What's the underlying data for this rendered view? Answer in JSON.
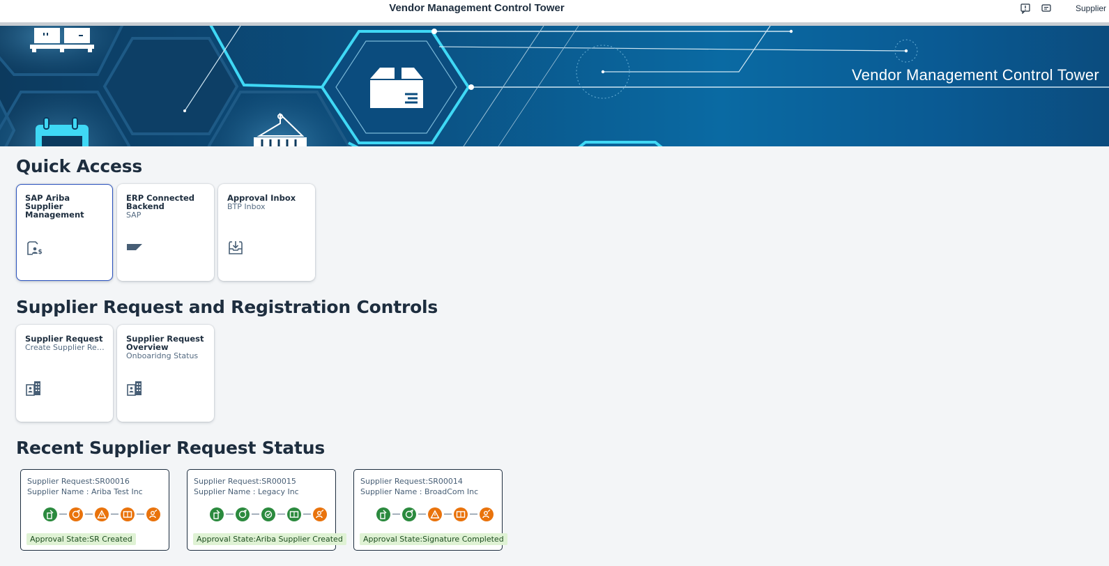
{
  "shell": {
    "title": "Vendor Management Control Tower",
    "user_label": "Supplier",
    "icons": [
      "feedback-icon",
      "notification-icon"
    ]
  },
  "banner": {
    "title": "Vendor Management Control Tower",
    "decorative_icons": [
      "pallet-icon",
      "box-icon",
      "calendar-icon",
      "container-icon"
    ]
  },
  "sections": {
    "quick_access": "Quick Access",
    "controls": "Supplier Request and Registration Controls",
    "recent": "Recent Supplier Request Status"
  },
  "quick_access_tiles": [
    {
      "title": "SAP Ariba Supplier Management",
      "subtitle": "",
      "icon": "supplier-management-icon"
    },
    {
      "title": "ERP Connected Backend",
      "subtitle": "SAP",
      "icon": "sap-backend-icon"
    },
    {
      "title": "Approval Inbox",
      "subtitle": "BTP Inbox",
      "icon": "inbox-download-icon"
    }
  ],
  "control_tiles": [
    {
      "title": "Supplier Request",
      "subtitle": "Create Supplier Req...",
      "icon": "building-icon"
    },
    {
      "title": "Supplier Request Overview",
      "subtitle": "Onboaridng Status",
      "icon": "building-icon"
    }
  ],
  "status_cards": [
    {
      "request": "Supplier Request:SR00016",
      "name": "Supplier Name : Ariba Test Inc",
      "state": "Approval State:SR Created",
      "steps": [
        "green",
        "orange",
        "orange",
        "orange",
        "orange"
      ]
    },
    {
      "request": "Supplier Request:SR00015",
      "name": "Supplier Name : Legacy Inc",
      "state": "Approval State:Ariba Supplier Created",
      "steps": [
        "green",
        "green",
        "green",
        "green",
        "orange"
      ]
    },
    {
      "request": "Supplier Request:SR00014",
      "name": "Supplier Name : BroadCom Inc",
      "state": "Approval State:Signature Completed",
      "steps": [
        "green",
        "green",
        "orange",
        "orange",
        "orange"
      ]
    }
  ],
  "step_icons": [
    "request-created-icon",
    "approval-cycle-icon",
    "review-icon",
    "supplier-record-icon",
    "user-check-icon"
  ],
  "colors": {
    "accent": "#2a52be",
    "success": "#2b8a3e",
    "warning": "#e9730c",
    "banner": "#0a6aa3",
    "glow": "#3fd8f5"
  }
}
